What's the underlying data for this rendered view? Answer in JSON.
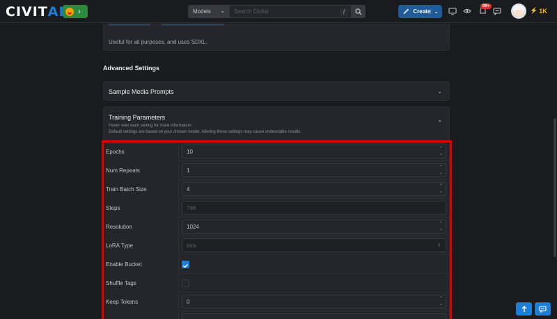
{
  "header": {
    "logo_main": "CIVIT",
    "logo_ai": "AI",
    "chip_arrow": "›",
    "search_scope": "Models",
    "search_placeholder": "Search Civitai",
    "search_shortcut": "/",
    "create_label": "Create",
    "notification_count": "99+",
    "buzz_amount": "1K",
    "accent_color": "#1c7ed6"
  },
  "top_card": {
    "description": "Useful for all purposes, and uses SDXL."
  },
  "advanced": {
    "title": "Advanced Settings",
    "sample_media_prompts": "Sample Media Prompts",
    "training_parameters": {
      "title": "Training Parameters",
      "hint1": "Hover over each setting for more information.",
      "hint2": "Default settings are based on your chosen model. Altering these settings may cause undesirable results."
    }
  },
  "params": [
    {
      "label": "Epochs",
      "value": "10",
      "type": "number"
    },
    {
      "label": "Num Repeats",
      "value": "1",
      "type": "number"
    },
    {
      "label": "Train Batch Size",
      "value": "4",
      "type": "number"
    },
    {
      "label": "Steps",
      "value": "798",
      "type": "disabled"
    },
    {
      "label": "Resolution",
      "value": "1024",
      "type": "number"
    },
    {
      "label": "LoRA Type",
      "value": "lora",
      "type": "select-disabled"
    },
    {
      "label": "Enable Bucket",
      "checked": true,
      "type": "checkbox"
    },
    {
      "label": "Shuffle Tags",
      "checked": false,
      "type": "checkbox"
    },
    {
      "label": "Keep Tokens",
      "value": "0",
      "type": "number"
    }
  ]
}
